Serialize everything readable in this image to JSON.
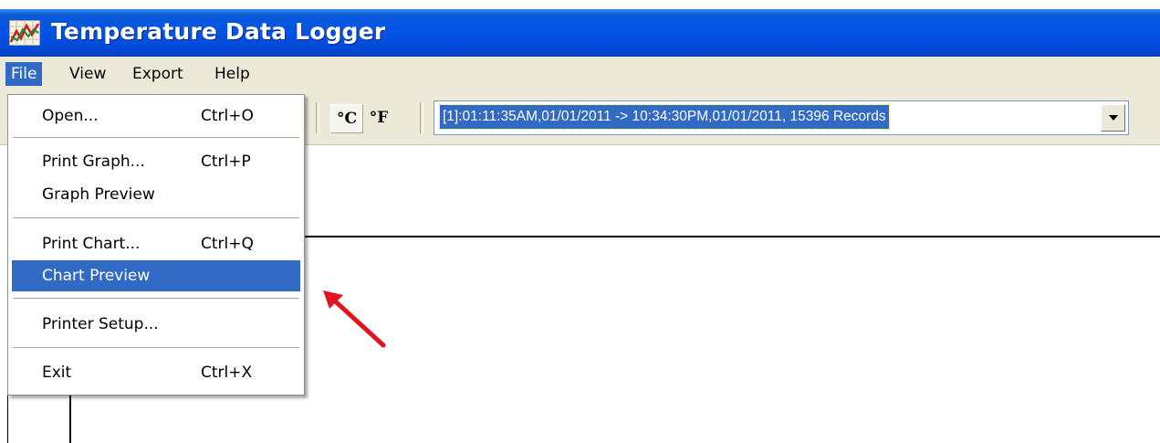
{
  "window": {
    "title": "Temperature Data Logger",
    "icon": "chart-line-icon",
    "title_bar_color": "#0353e6"
  },
  "menubar": {
    "items": [
      "File",
      "View",
      "Export",
      "Help"
    ],
    "active": "File"
  },
  "toolbar": {
    "celsius_label": "°C",
    "fahrenheit_label": "°F",
    "record_selection": "[1]:01:11:35AM,01/01/2011 -> 10:34:30PM,01/01/2011, 15396 Records"
  },
  "file_menu": {
    "items": [
      {
        "label": "Open...",
        "shortcut": "Ctrl+O"
      },
      {
        "label": "Print Graph...",
        "shortcut": "Ctrl+P"
      },
      {
        "label": "Graph Preview",
        "shortcut": ""
      },
      {
        "label": "Print Chart...",
        "shortcut": "Ctrl+Q"
      },
      {
        "label": "Chart Preview",
        "shortcut": ""
      },
      {
        "label": "Printer Setup...",
        "shortcut": ""
      },
      {
        "label": "Exit",
        "shortcut": "Ctrl+X"
      }
    ],
    "highlighted": "Chart Preview",
    "highlight_color": "#316ac5"
  },
  "annotation": {
    "arrow_color": "#e0141e",
    "points_to": "Chart Preview"
  }
}
